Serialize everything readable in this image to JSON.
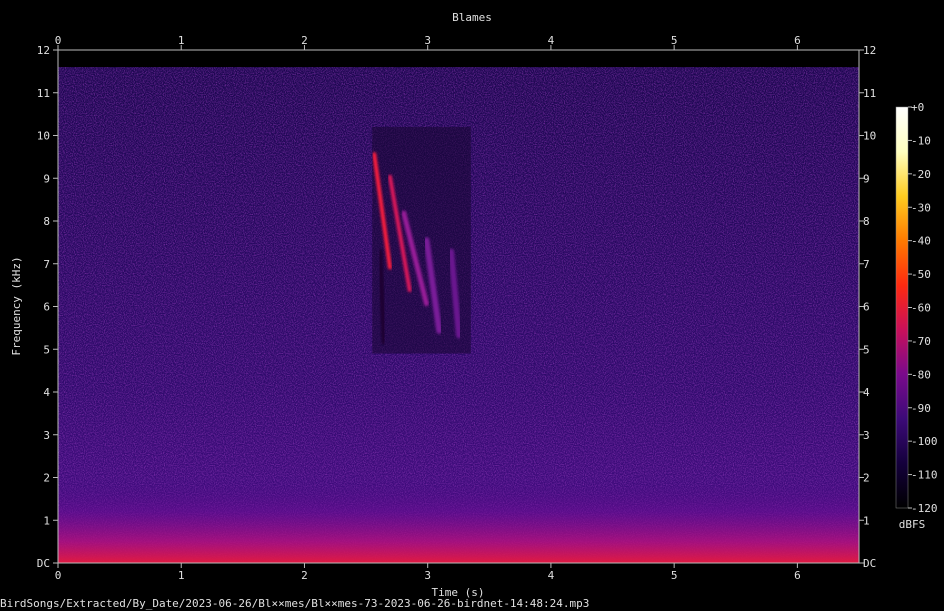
{
  "chart_data": {
    "type": "heatmap",
    "title": "Blames",
    "xlabel": "Time (s)",
    "ylabel": "Frequency (kHz)",
    "xlim": [
      0,
      6.5
    ],
    "ylim": [
      0,
      11.6
    ],
    "x_ticks": [
      "0",
      "1",
      "2",
      "3",
      "4",
      "5",
      "6"
    ],
    "y_ticks": [
      "DC",
      "1",
      "2",
      "3",
      "4",
      "5",
      "6",
      "7",
      "8",
      "9",
      "10",
      "11",
      "12"
    ],
    "colorbar": {
      "label": "dBFS",
      "range": [
        -120,
        0
      ],
      "ticks": [
        "+0",
        "-10",
        "-20",
        "-30",
        "-40",
        "-50",
        "-60",
        "-70",
        "-80",
        "-90",
        "-100",
        "-110",
        "-120"
      ],
      "colors": [
        "#000000",
        "#14003c",
        "#3c0a78",
        "#7a0a8c",
        "#c8105a",
        "#ff2a10",
        "#ff7a00",
        "#ffcc20",
        "#ffffc0",
        "#ffffff"
      ]
    },
    "events": [
      {
        "t_start": 2.55,
        "t_end": 3.35,
        "f_low": 4.9,
        "f_high": 10.2,
        "peak_dbfs": -55
      }
    ],
    "background_dbfs": -95,
    "low_freq_band": {
      "f_low": 0,
      "f_high": 1.2,
      "peak_dbfs": -55
    }
  },
  "footer": {
    "file_path": "BirdSongs/Extracted/By_Date/2023-06-26/Bl××mes/Bl××mes-73-2023-06-26-birdnet-14:48:24.mp3"
  }
}
